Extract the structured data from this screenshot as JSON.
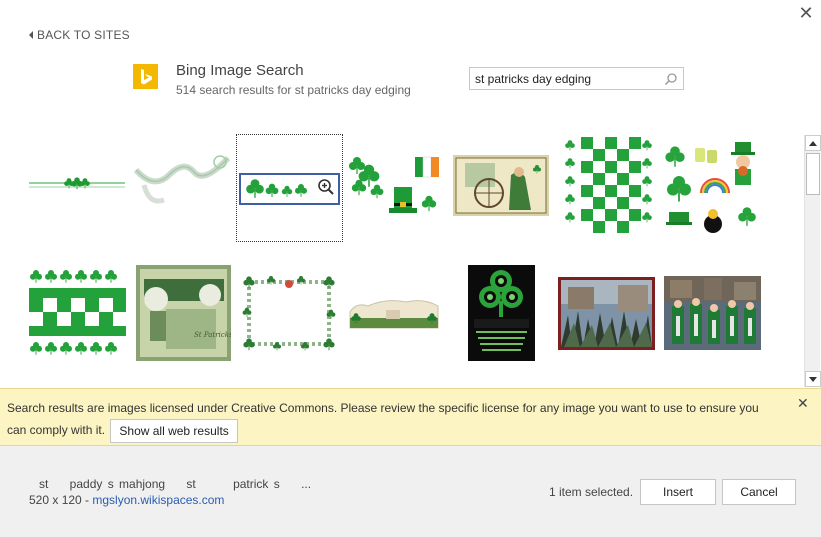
{
  "dialog": {
    "close_glyph": "✕",
    "back_label": "BACK TO SITES"
  },
  "header": {
    "provider": "Bing Image Search",
    "result_count_text": "514 search results for st patricks day edging"
  },
  "search": {
    "value": "st patricks day edging",
    "icon": "search-icon"
  },
  "results": [
    {
      "id": 1,
      "name": "shamrock-border-line"
    },
    {
      "id": 2,
      "name": "white-ribbon-curl"
    },
    {
      "id": 3,
      "name": "shamrock-row-banner",
      "selected": true
    },
    {
      "id": 4,
      "name": "shamrocks-hat-flag"
    },
    {
      "id": 5,
      "name": "vintage-spinning-postcard"
    },
    {
      "id": 6,
      "name": "green-checkered-border"
    },
    {
      "id": 7,
      "name": "leprechaun-clipart-set"
    },
    {
      "id": 8,
      "name": "shamrock-checker-border"
    },
    {
      "id": 9,
      "name": "scrapbook-page"
    },
    {
      "id": 10,
      "name": "shamrock-frame"
    },
    {
      "id": 11,
      "name": "vintage-landscape-strip"
    },
    {
      "id": 12,
      "name": "st-patricks-poster"
    },
    {
      "id": 13,
      "name": "garden-photo"
    },
    {
      "id": 14,
      "name": "parade-photo"
    }
  ],
  "notice": {
    "message": "Search results are images licensed under Creative Commons. Please review the specific license for any image you want to use to ensure you can comply with it.",
    "button_label": "Show all web results",
    "close_glyph": "✕"
  },
  "footer": {
    "image_title": "st    paddy s mahjong    st       patrick s    ...",
    "dimensions": "520 x 120 - ",
    "source_link": "mgslyon.wikispaces.com",
    "selection_text": "1 item selected.",
    "insert_label": "Insert",
    "cancel_label": "Cancel"
  },
  "colors": {
    "shamrock_green": "#22a33a",
    "bing_yellow": "#f5b800",
    "notice_bg": "#fcf4c2",
    "link_blue": "#2a5db0"
  }
}
